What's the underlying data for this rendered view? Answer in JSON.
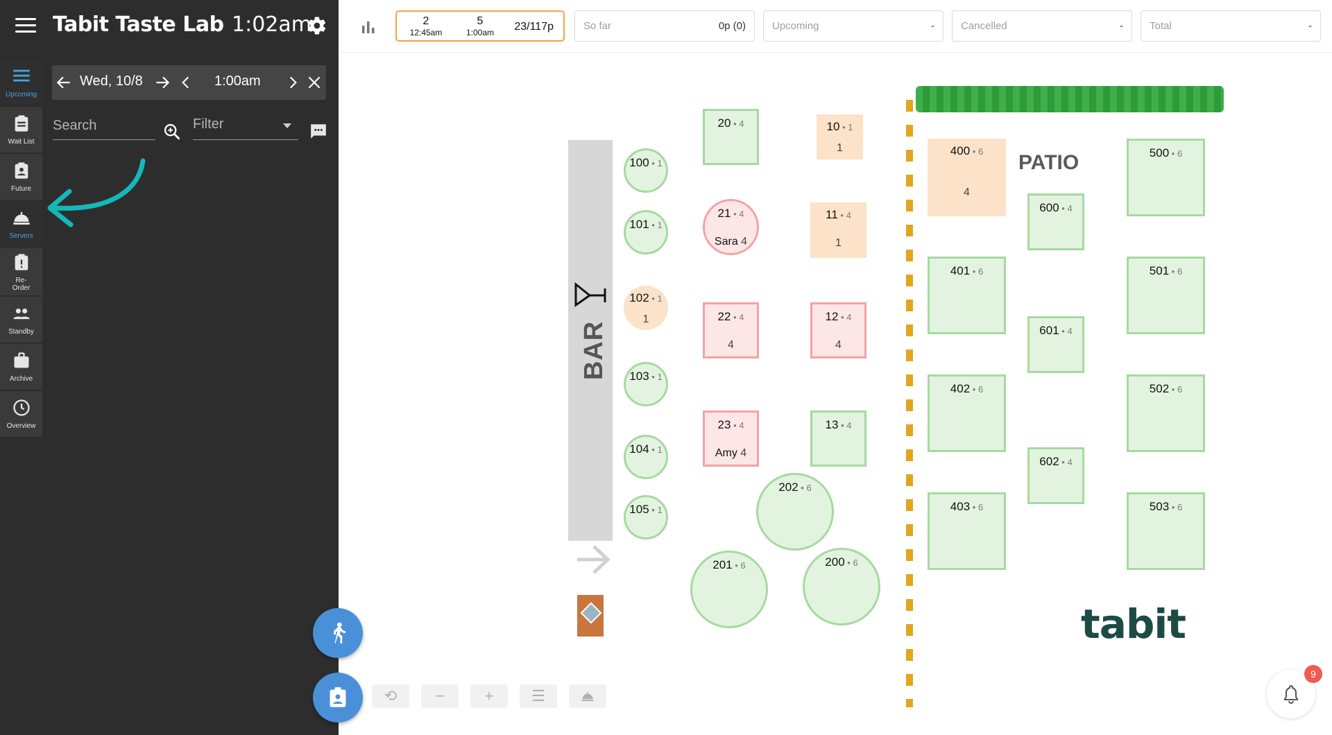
{
  "header": {
    "app_title": "Tabit Taste Lab",
    "clock": "1:02am"
  },
  "nav": [
    {
      "label": "Upcoming",
      "icon": "list-icon",
      "active": true
    },
    {
      "label": "Wait List",
      "icon": "clipboard-icon"
    },
    {
      "label": "Future",
      "icon": "clipboard-person-icon"
    },
    {
      "label": "Servers",
      "icon": "server-bell-icon"
    },
    {
      "label": "Re-\nOrder",
      "icon": "reorder-icon"
    },
    {
      "label": "Standby",
      "icon": "people-icon"
    },
    {
      "label": "Archive",
      "icon": "briefcase-icon"
    },
    {
      "label": "Overview",
      "icon": "clock-icon"
    }
  ],
  "datebar": {
    "date": "Wed, 10/8",
    "time": "1:00am"
  },
  "search": {
    "placeholder": "Search"
  },
  "filter": {
    "placeholder": "Filter"
  },
  "pacing": {
    "slots": [
      {
        "count": "2",
        "time": "12:45am"
      },
      {
        "count": "5",
        "time": "1:00am"
      }
    ],
    "total": "23/117p"
  },
  "stats": [
    {
      "label": "So far",
      "value": "0p (0)"
    },
    {
      "label": "Upcoming",
      "value": "-"
    },
    {
      "label": "Cancelled",
      "value": "-"
    },
    {
      "label": "Total",
      "value": "-"
    }
  ],
  "floor": {
    "bar_label": "BAR",
    "patio_label": "PATIO",
    "logo_text": "tabit",
    "tables": [
      {
        "num": "100",
        "size": "1"
      },
      {
        "num": "101",
        "size": "1"
      },
      {
        "num": "102",
        "size": "1",
        "covers": "1",
        "status": "reserved"
      },
      {
        "num": "103",
        "size": "1"
      },
      {
        "num": "104",
        "size": "1"
      },
      {
        "num": "105",
        "size": "1"
      },
      {
        "num": "20",
        "size": "4"
      },
      {
        "num": "21",
        "size": "4",
        "server": "Sara",
        "covers": "4",
        "status": "seated"
      },
      {
        "num": "22",
        "size": "4",
        "covers": "4",
        "status": "seated"
      },
      {
        "num": "23",
        "size": "4",
        "server": "Amy",
        "covers": "4",
        "status": "seated"
      },
      {
        "num": "10",
        "size": "1",
        "covers": "1",
        "status": "reserved"
      },
      {
        "num": "11",
        "size": "4",
        "covers": "1",
        "status": "reserved"
      },
      {
        "num": "12",
        "size": "4",
        "covers": "4",
        "status": "seated"
      },
      {
        "num": "13",
        "size": "4"
      },
      {
        "num": "202",
        "size": "6"
      },
      {
        "num": "201",
        "size": "6"
      },
      {
        "num": "200",
        "size": "6"
      },
      {
        "num": "400",
        "size": "6",
        "covers": "4",
        "status": "reserved"
      },
      {
        "num": "401",
        "size": "6"
      },
      {
        "num": "402",
        "size": "6"
      },
      {
        "num": "403",
        "size": "6"
      },
      {
        "num": "600",
        "size": "4"
      },
      {
        "num": "601",
        "size": "4"
      },
      {
        "num": "602",
        "size": "4"
      },
      {
        "num": "500",
        "size": "6"
      },
      {
        "num": "501",
        "size": "6"
      },
      {
        "num": "502",
        "size": "6"
      },
      {
        "num": "503",
        "size": "6"
      }
    ]
  },
  "notifications": {
    "count": "9"
  },
  "colors": {
    "accent": "#4a90d9",
    "available": "#e2f4df",
    "seated": "#fde6e6",
    "reserved": "#fbe2c8",
    "annotation": "#14b8b8"
  }
}
